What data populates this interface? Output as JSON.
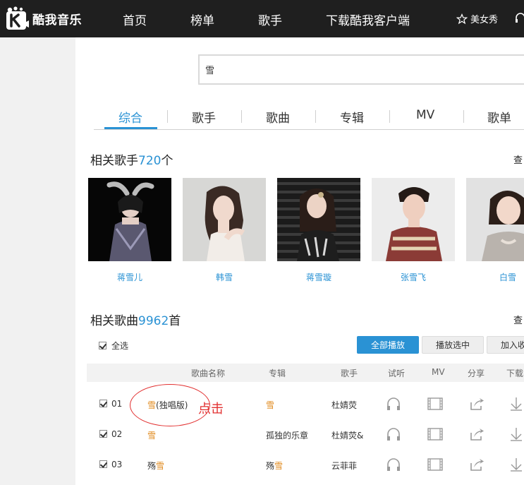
{
  "app": {
    "logo_text": "酷我音乐"
  },
  "nav": {
    "items": [
      {
        "label": "首页"
      },
      {
        "label": "榜单"
      },
      {
        "label": "歌手"
      },
      {
        "label": "下载酷我客户端"
      }
    ],
    "meinv_label": "美女秀"
  },
  "search": {
    "value": "雪"
  },
  "tabs": [
    {
      "label": "综合",
      "active": true
    },
    {
      "label": "歌手"
    },
    {
      "label": "歌曲"
    },
    {
      "label": "专辑"
    },
    {
      "label": "MV"
    },
    {
      "label": "歌单"
    }
  ],
  "singers_section": {
    "title_prefix": "相关歌手",
    "count": "720",
    "title_suffix": "个",
    "view_all": "查"
  },
  "singers": [
    {
      "name": "蒋雪儿"
    },
    {
      "name": "韩雪"
    },
    {
      "name": "蒋雪璇"
    },
    {
      "name": "张雪飞"
    },
    {
      "name": "白雪"
    }
  ],
  "songs_section": {
    "title_prefix": "相关歌曲",
    "count": "9962",
    "title_suffix": "首",
    "view_all": "查"
  },
  "song_controls": {
    "select_all": "全选",
    "play_all": "全部播放",
    "play_selected": "播放选中",
    "add_to": "加入收"
  },
  "table_headers": {
    "name": "歌曲名称",
    "album": "专辑",
    "artist": "歌手",
    "listen": "试听",
    "mv": "MV",
    "share": "分享",
    "download": "下载"
  },
  "songs": [
    {
      "index": "01",
      "title_hl": "雪",
      "title_rest": "(独唱版)",
      "album_pre": "",
      "album_hl": "雪",
      "artist": "杜婧荧"
    },
    {
      "index": "02",
      "title_hl": "雪",
      "title_rest": "",
      "album_pre": "孤独的乐章",
      "album_hl": "",
      "artist": "杜婧荧&"
    },
    {
      "index": "03",
      "title_pre": "殇",
      "title_hl": "雪",
      "title_rest": "",
      "album_pre": "殇",
      "album_hl": "雪",
      "artist": "云菲菲"
    }
  ],
  "annotation": {
    "text": "点击"
  },
  "colors": {
    "accent": "#2a92d4",
    "highlight": "#e08a1e",
    "annotation": "#e23030",
    "nav_bg": "#1f1f1f"
  }
}
